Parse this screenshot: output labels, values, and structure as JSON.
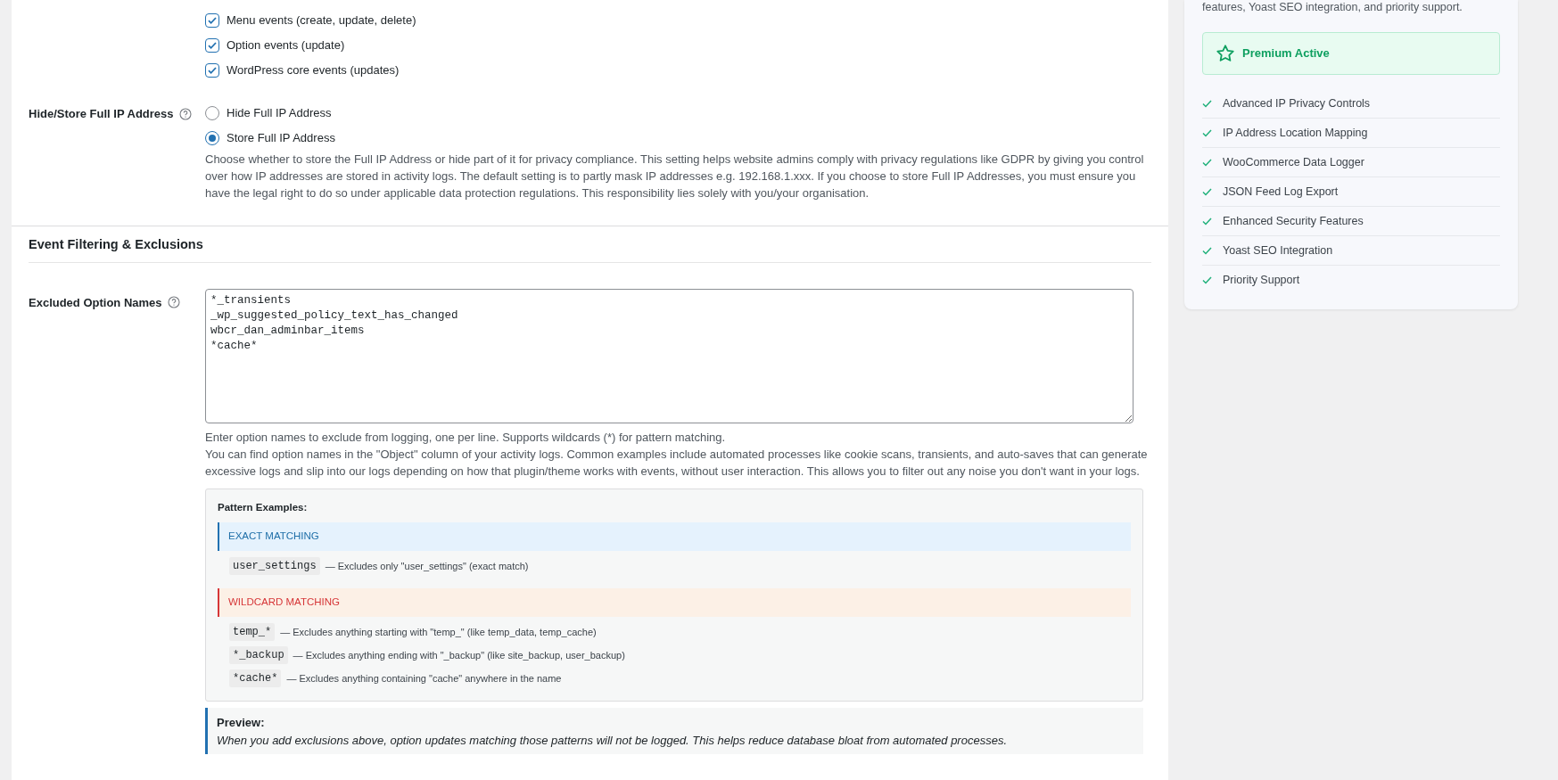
{
  "event_checkboxes": [
    {
      "label": "Menu events (create, update, delete)",
      "checked": true
    },
    {
      "label": "Option events (update)",
      "checked": true
    },
    {
      "label": "WordPress core events (updates)",
      "checked": true
    }
  ],
  "ip_setting": {
    "label": "Hide/Store Full IP Address",
    "options": [
      {
        "label": "Hide Full IP Address",
        "selected": false
      },
      {
        "label": "Store Full IP Address",
        "selected": true
      }
    ],
    "description": "Choose whether to store the Full IP Address or hide part of it for privacy compliance. This setting helps website admins comply with privacy regulations like GDPR by giving you control over how IP addresses are stored in activity logs. The default setting is to partly mask IP addresses e.g. 192.168.1.xxx. If you choose to store Full IP Addresses, you must ensure you have the legal right to do so under applicable data protection regulations. This responsibility lies solely with you/your organisation."
  },
  "section": {
    "title": "Event Filtering & Exclusions"
  },
  "excluded_options": {
    "label": "Excluded Option Names",
    "value": "*_transients\n_wp_suggested_policy_text_has_changed\nwbcr_dan_adminbar_items\n*cache*",
    "help": [
      "Enter option names to exclude from logging, one per line. Supports wildcards (*) for pattern matching.",
      "You can find option names in the \"Object\" column of your activity logs. Common examples include automated processes like cookie scans, transients, and auto-saves that can generate excessive logs and slip into our logs depending on how that plugin/theme works with events, without user interaction. This allows you to filter out any noise you don't want in your logs."
    ]
  },
  "pattern_examples": {
    "title": "Pattern Examples:",
    "groups": [
      {
        "kind": "exact",
        "title": "EXACT MATCHING",
        "items": [
          {
            "code": "user_settings",
            "text": "— Excludes only \"user_settings\" (exact match)"
          }
        ]
      },
      {
        "kind": "wildcard",
        "title": "WILDCARD MATCHING",
        "items": [
          {
            "code": "temp_*",
            "text": "— Excludes anything starting with \"temp_\" (like temp_data, temp_cache)"
          },
          {
            "code": "*_backup",
            "text": "— Excludes anything ending with \"_backup\" (like site_backup, user_backup)"
          },
          {
            "code": "*cache*",
            "text": "— Excludes anything containing \"cache\" anywhere in the name"
          }
        ]
      }
    ]
  },
  "preview": {
    "title": "Preview:",
    "text": "When you add exclusions above, option updates matching those patterns will not be logged. This helps reduce database bloat from automated processes."
  },
  "sidebar": {
    "intro": "features, Yoast SEO integration, and priority support.",
    "status": "Premium Active",
    "features": [
      "Advanced IP Privacy Controls",
      "IP Address Location Mapping",
      "WooCommerce Data Logger",
      "JSON Feed Log Export",
      "Enhanced Security Features",
      "Yoast SEO Integration",
      "Priority Support"
    ]
  }
}
